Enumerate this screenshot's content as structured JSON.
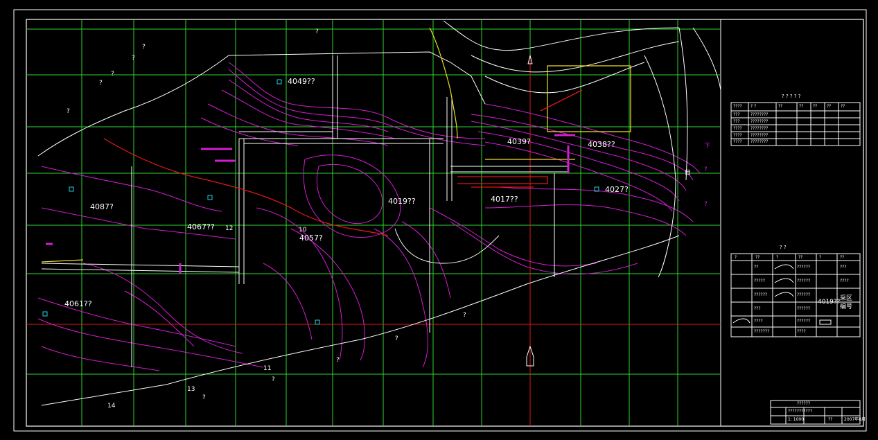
{
  "drawing": {
    "background": "#000000",
    "colors": {
      "grid": "#2fd52f",
      "contour": "#d21ed2",
      "road": "#ffffff",
      "fault": "#e01818",
      "yellow": "#f0e020",
      "cyan": "#22d3e0",
      "frame": "#ffffff"
    }
  },
  "map_labels": {
    "area_4049": "4049??",
    "area_4039": "4039?",
    "area_4038": "4038??",
    "area_4027": "4027?",
    "area_4019": "4019??",
    "area_4017": "4017??",
    "area_4057": "4057?",
    "area_4087": "4087?",
    "area_4067": "4067??",
    "area_4061": "4061??",
    "num_10": "10",
    "num_11": "11",
    "num_12": "12",
    "num_13": "13",
    "num_14": "14",
    "q": "?"
  },
  "side_right": {
    "char_1": "下",
    "char_2": "?",
    "char_3": "?",
    "char_4": "目"
  },
  "table1": {
    "title": "? ? ? ? ?",
    "header": [
      "????",
      "? ?",
      "??",
      "?",
      "??",
      "??",
      "?",
      "??",
      "??"
    ],
    "rows": [
      [
        "???",
        "???",
        "????????",
        "????",
        "1",
        "???",
        "??",
        "???",
        "????"
      ],
      [
        "???",
        "???",
        "????????",
        "????",
        "1",
        "???",
        "??",
        "???",
        "????"
      ],
      [
        "????",
        "???",
        "????????",
        "????",
        "1",
        "???",
        "??",
        "???",
        "????"
      ],
      [
        "????",
        "???",
        "????????",
        "????",
        "1",
        "???",
        "??",
        "???",
        "????"
      ],
      [
        "????",
        "???",
        "????????",
        "????",
        "1",
        "???",
        "??",
        "???",
        "????"
      ]
    ]
  },
  "legend": {
    "title": "? ?",
    "header": [
      "?",
      "??",
      "?",
      "??",
      "?",
      "??"
    ],
    "cells": [
      [
        "??",
        "??????",
        "??",
        "???"
      ],
      [
        "?????",
        "??????",
        "????",
        "????"
      ],
      [
        "??????",
        "??????",
        "?????",
        "?????"
      ],
      [
        "???",
        "??",
        "??????",
        ""
      ],
      [
        "????",
        "??",
        "??????",
        ""
      ],
      [
        "???????",
        "???",
        "????",
        ""
      ]
    ],
    "label_4019": "4019??",
    "label_block": "采区\n编号"
  },
  "title_block": {
    "heading": "??????",
    "name": "???????????",
    "scale": "1: 1000",
    "sheet": "??",
    "date": "2007年8月"
  }
}
